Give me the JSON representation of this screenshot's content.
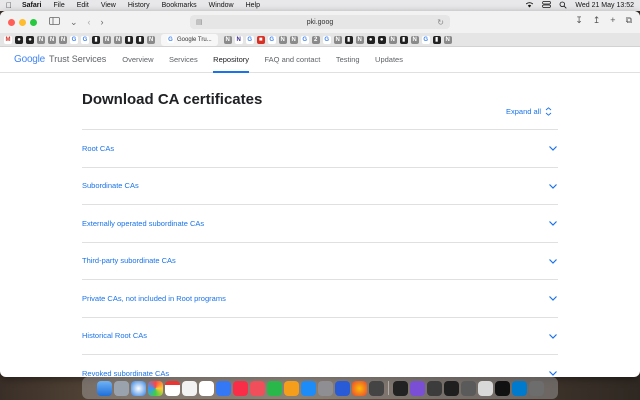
{
  "menubar": {
    "app_name": "Safari",
    "items": [
      "File",
      "Edit",
      "View",
      "History",
      "Bookmarks",
      "Window",
      "Help"
    ],
    "clock": "Wed 21 May  13:52"
  },
  "toolbar": {
    "url": "pki.goog"
  },
  "tabs": {
    "active_label": "Google Tru..."
  },
  "site": {
    "logo_google": "Google",
    "logo_product": "Trust Services",
    "nav": [
      "Overview",
      "Services",
      "Repository",
      "FAQ and contact",
      "Testing",
      "Updates"
    ],
    "active_nav": "Repository"
  },
  "main": {
    "title": "Download CA certificates",
    "expand_all": "Expand all",
    "sections": [
      "Root CAs",
      "Subordinate CAs",
      "Externally operated subordinate CAs",
      "Third-party subordinate CAs",
      "Private CAs, not included in Root programs",
      "Historical Root CAs",
      "Revoked subordinate CAs"
    ]
  },
  "colors": {
    "accent": "#1a73e8",
    "text": "#202124",
    "muted": "#5f6368"
  }
}
